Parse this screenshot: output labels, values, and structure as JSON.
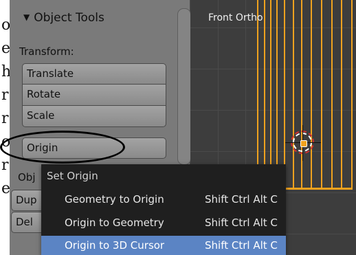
{
  "doc_strip": {
    "chars": [
      "o",
      "e",
      "h",
      "r",
      "r",
      "o",
      "r",
      "e"
    ]
  },
  "panel": {
    "header": "Object Tools",
    "transform_label": "Transform:",
    "buttons": [
      "Translate",
      "Rotate",
      "Scale"
    ],
    "origin_button": "Origin",
    "object_label_partial": "Obj",
    "partial_buttons": [
      "Dup",
      "Del"
    ]
  },
  "viewport": {
    "label": "Front Ortho"
  },
  "popup": {
    "title": "Set Origin",
    "items": [
      {
        "label": "Geometry to Origin",
        "shortcut": "Shift Ctrl Alt C",
        "highlighted": false
      },
      {
        "label": "Origin to Geometry",
        "shortcut": "Shift Ctrl Alt C",
        "highlighted": false
      },
      {
        "label": "Origin to 3D Cursor",
        "shortcut": "Shift Ctrl Alt C",
        "highlighted": true
      }
    ]
  },
  "colors": {
    "mesh": "#f0a21e",
    "highlight": "#5b84c4",
    "panel": "#7a7a7a",
    "viewport": "#3d3d3d",
    "menu_bg": "#1f1f1f"
  }
}
